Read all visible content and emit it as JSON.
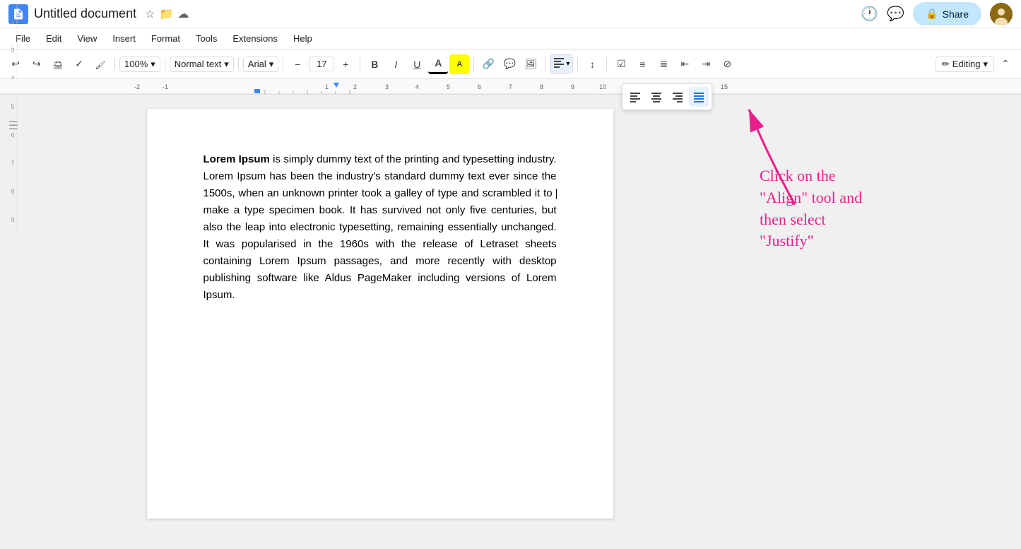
{
  "app": {
    "name": "Untitled document",
    "icon_color": "#4285f4"
  },
  "title_bar": {
    "title": "Untitled document",
    "share_label": "Share",
    "history_icon": "history-icon",
    "comment_icon": "chat-icon"
  },
  "menu": {
    "items": [
      "File",
      "Edit",
      "View",
      "Insert",
      "Format",
      "Tools",
      "Extensions",
      "Help"
    ]
  },
  "toolbar": {
    "zoom": "100%",
    "style": "Normal text",
    "font": "Arial",
    "font_size": "17",
    "editing_mode": "Editing"
  },
  "alignment_popup": {
    "buttons": [
      "align-left",
      "align-center",
      "align-right",
      "align-justify"
    ],
    "active": "align-justify"
  },
  "document": {
    "paragraph": "Lorem Ipsum is simply dummy text of the printing and typesetting industry. Lorem Ipsum has been the industry's standard dummy text ever since the 1500s, when an unknown printer took a galley of type and scrambled it to make a type specimen book. It has survived not only five centuries, but also the leap into electronic typesetting, remaining essentially unchanged. It was popularised in the 1960s with the release of Letraset sheets containing Lorem Ipsum passages, and more recently with desktop publishing software like Aldus PageMaker including versions of Lorem Ipsum.",
    "bold_start": "Lorem Ipsum"
  },
  "annotation": {
    "text": "Click on the\n“Align” tool and\nthen select\n“Justify”",
    "color": "#e91e8c"
  }
}
